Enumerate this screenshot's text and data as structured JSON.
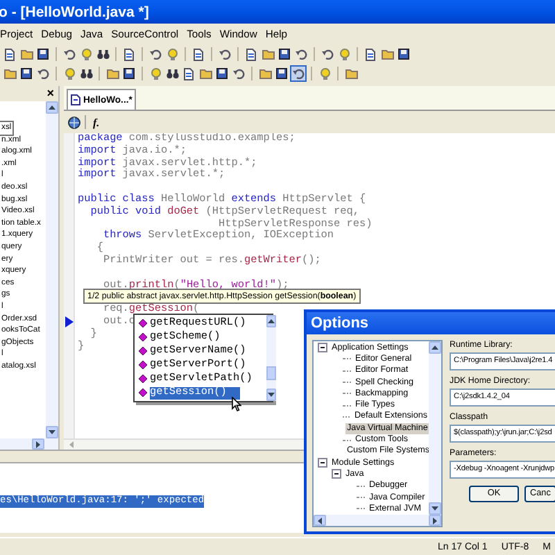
{
  "window": {
    "title": "o - [HelloWorld.java *]"
  },
  "menu": [
    "Project",
    "Debug",
    "Java",
    "SourceControl",
    "Tools",
    "Window",
    "Help"
  ],
  "toolbar_rows": [
    {
      "groups": [
        [
          {
            "pressed": false
          },
          {
            "pressed": false
          },
          {
            "pressed": false
          }
        ],
        [
          {
            "pressed": false
          },
          {
            "pressed": false
          },
          {
            "pressed": false
          }
        ],
        [
          {
            "pressed": false
          }
        ],
        [
          {
            "pressed": false
          },
          {
            "pressed": false
          }
        ],
        [
          {
            "pressed": false
          }
        ],
        [
          {
            "pressed": false
          }
        ],
        [
          {
            "pressed": false
          },
          {
            "pressed": false
          },
          {
            "pressed": false
          },
          {
            "pressed": false
          }
        ],
        [
          {
            "pressed": false
          },
          {
            "pressed": false
          }
        ],
        [
          {
            "pressed": false
          },
          {
            "pressed": false
          },
          {
            "pressed": false
          }
        ]
      ]
    },
    {
      "groups": [
        [
          {
            "pressed": false
          },
          {
            "pressed": false
          },
          {
            "pressed": false
          }
        ],
        [
          {
            "pressed": false
          },
          {
            "pressed": false
          }
        ],
        [
          {
            "pressed": false
          },
          {
            "pressed": false
          }
        ],
        [
          {
            "pressed": false
          },
          {
            "pressed": false
          },
          {
            "pressed": false
          },
          {
            "pressed": false
          },
          {
            "pressed": false
          },
          {
            "pressed": false
          }
        ],
        [
          {
            "pressed": false
          },
          {
            "pressed": false
          },
          {
            "pressed": true
          }
        ],
        [
          {
            "pressed": false
          }
        ],
        [
          {
            "pressed": false
          }
        ]
      ]
    }
  ],
  "project_panel": {
    "close": "×",
    "items": [
      {
        "label": "xsl",
        "selected": true
      },
      {
        "label": "n.xml",
        "selected": false
      },
      {
        "label": "alog.xml",
        "selected": false
      },
      {
        "label": ".xml",
        "selected": false
      },
      {
        "label": "l",
        "selected": false
      },
      {
        "label": "deo.xsl",
        "selected": false
      },
      {
        "label": "bug.xsl",
        "selected": false
      },
      {
        "label": "Video.xsl",
        "selected": false
      },
      {
        "label": "tion table.x",
        "selected": false
      },
      {
        "label": "1.xquery",
        "selected": false
      },
      {
        "label": "query",
        "selected": false
      },
      {
        "label": "ery",
        "selected": false
      },
      {
        "label": "xquery",
        "selected": false
      },
      {
        "label": "ces",
        "selected": false
      },
      {
        "label": "gs",
        "selected": false
      },
      {
        "label": "l",
        "selected": false
      },
      {
        "label": "Order.xsd",
        "selected": false
      },
      {
        "label": "ooksToCat",
        "selected": false
      },
      {
        "label": "gObjects",
        "selected": false
      },
      {
        "label": "l",
        "selected": false
      },
      {
        "label": "atalog.xsl",
        "selected": false
      }
    ]
  },
  "editor": {
    "tabs": [
      {
        "label": "HelloWo...*",
        "selected": true
      }
    ],
    "function_button": "f.",
    "lines": [
      {
        "kind": "code",
        "current": false,
        "tokens": [
          {
            "kind": "kw",
            "text": "package"
          },
          {
            "kind": "id",
            "text": " com.stylusstudio.examples;"
          }
        ]
      },
      {
        "kind": "code",
        "current": false,
        "tokens": [
          {
            "kind": "kw",
            "text": "import"
          },
          {
            "kind": "id",
            "text": " java.io.*;"
          }
        ]
      },
      {
        "kind": "code",
        "current": false,
        "tokens": [
          {
            "kind": "kw",
            "text": "import"
          },
          {
            "kind": "id",
            "text": " javax.servlet.http.*;"
          }
        ]
      },
      {
        "kind": "code",
        "current": false,
        "tokens": [
          {
            "kind": "kw",
            "text": "import"
          },
          {
            "kind": "id",
            "text": " javax.servlet.*;"
          }
        ]
      },
      {
        "kind": "blank"
      },
      {
        "kind": "code",
        "current": false,
        "tokens": [
          {
            "kind": "kw",
            "text": "public class"
          },
          {
            "kind": "id",
            "text": " HelloWorld "
          },
          {
            "kind": "kw",
            "text": "extends"
          },
          {
            "kind": "id",
            "text": " HttpServlet {"
          }
        ]
      },
      {
        "kind": "code",
        "current": false,
        "tokens": [
          {
            "kind": "kw",
            "text": "  public void"
          },
          {
            "kind": "fn",
            "text": " doGet"
          },
          {
            "kind": "id",
            "text": " (HttpServletRequest req,"
          }
        ]
      },
      {
        "kind": "code",
        "current": false,
        "tokens": [
          {
            "kind": "id",
            "text": "                      HttpServletResponse res)"
          }
        ]
      },
      {
        "kind": "code",
        "current": false,
        "tokens": [
          {
            "kind": "kw",
            "text": "    throws"
          },
          {
            "kind": "id",
            "text": " ServletException, IOException"
          }
        ]
      },
      {
        "kind": "code",
        "current": false,
        "tokens": [
          {
            "kind": "id",
            "text": "   {"
          }
        ]
      },
      {
        "kind": "code",
        "current": false,
        "tokens": [
          {
            "kind": "id",
            "text": "    PrintWriter out = res."
          },
          {
            "kind": "fn",
            "text": "getWriter"
          },
          {
            "kind": "id",
            "text": "();"
          }
        ]
      },
      {
        "kind": "blank"
      },
      {
        "kind": "code",
        "current": false,
        "tokens": [
          {
            "kind": "id",
            "text": "    out."
          },
          {
            "kind": "fn",
            "text": "println"
          },
          {
            "kind": "id",
            "text": "("
          },
          {
            "kind": "str",
            "text": "\"Hello, world!\""
          },
          {
            "kind": "id",
            "text": ");"
          }
        ]
      },
      {
        "kind": "blank"
      },
      {
        "kind": "code",
        "current": false,
        "tokens": [
          {
            "kind": "id",
            "text": "    req."
          },
          {
            "kind": "fn",
            "text": "getSession"
          },
          {
            "kind": "id",
            "text": "("
          }
        ]
      },
      {
        "kind": "code",
        "current": true,
        "tokens": [
          {
            "kind": "id",
            "text": "    out.c"
          }
        ]
      },
      {
        "kind": "code",
        "current": false,
        "tokens": [
          {
            "kind": "id",
            "text": "  }"
          }
        ]
      },
      {
        "kind": "code",
        "current": false,
        "tokens": [
          {
            "kind": "id",
            "text": "}"
          }
        ]
      }
    ],
    "tooltip": "1/2 public abstract javax.servlet.http.HttpSession getSession(**boolean**)",
    "completions": [
      {
        "label": "getRequestURL()",
        "selected": false
      },
      {
        "label": "getScheme()",
        "selected": false
      },
      {
        "label": "getServerName()",
        "selected": false
      },
      {
        "label": "getServerPort()",
        "selected": false
      },
      {
        "label": "getServletPath()",
        "selected": false
      },
      {
        "label": "getSession()",
        "selected": true
      }
    ]
  },
  "output": {
    "lines": [
      {
        "text": "es\\HelloWorld.java:17: ';' expected",
        "selected": true
      }
    ]
  },
  "status_bar": [
    "Ln 17 Col 1",
    "UTF-8",
    "M"
  ],
  "options_dialog": {
    "title": "Options",
    "tree": [
      {
        "label": "Application Settings",
        "expanded": true,
        "selected": false,
        "children": [
          {
            "label": "Editor General",
            "selected": false
          },
          {
            "label": "Editor Format",
            "selected": false
          },
          {
            "label": "Spell Checking",
            "selected": false
          },
          {
            "label": "Backmapping",
            "selected": false
          },
          {
            "label": "File Types",
            "selected": false
          },
          {
            "label": "Default Extensions",
            "selected": false
          },
          {
            "label": "Java Virtual Machine",
            "selected": true
          },
          {
            "label": "Custom Tools",
            "selected": false
          },
          {
            "label": "Custom File Systems",
            "selected": false
          }
        ]
      },
      {
        "label": "Module Settings",
        "expanded": true,
        "selected": false,
        "children": [
          {
            "label": "Java",
            "expanded": true,
            "selected": false,
            "children": [
              {
                "label": "Debugger",
                "selected": false
              },
              {
                "label": "Java Compiler",
                "selected": false
              },
              {
                "label": "External JVM",
                "selected": false
              }
            ]
          }
        ]
      }
    ],
    "fields": [
      {
        "label": "Runtime Library:",
        "value": "C:\\Program Files\\Java\\j2re1.4"
      },
      {
        "label": "JDK Home Directory:",
        "value": "C:\\j2sdk1.4.2_04"
      },
      {
        "label": "Classpath",
        "value": "$(classpath);y:\\jrun.jar;C:\\j2sd"
      },
      {
        "label": "Parameters:",
        "value": "-Xdebug -Xnoagent -Xrunjdwp"
      }
    ],
    "buttons": [
      "OK",
      "Canc"
    ]
  }
}
